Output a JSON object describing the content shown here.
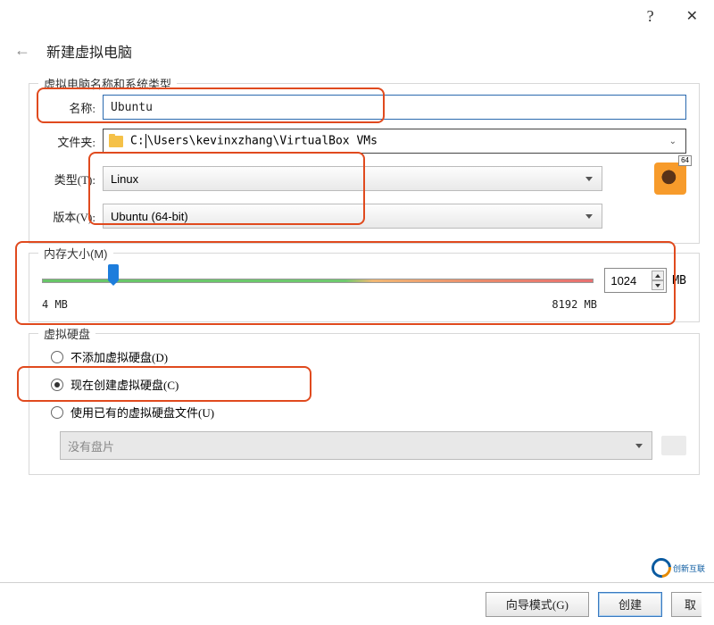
{
  "titlebar": {
    "help": "?",
    "close": "✕"
  },
  "header": {
    "back": "←",
    "title": "新建虚拟电脑"
  },
  "group_name": {
    "legend": "虚拟电脑名称和系统类型",
    "name_label": "名称:",
    "name_value": "Ubuntu",
    "folder_label": "文件夹:",
    "folder_value": "C:\\Users\\kevinxzhang\\VirtualBox VMs",
    "type_label": "类型(T):",
    "type_value": "Linux",
    "version_label": "版本(V):",
    "version_value": "Ubuntu (64-bit)",
    "os_badge": "64"
  },
  "memory": {
    "legend": "内存大小(M)",
    "min": "4 MB",
    "max": "8192 MB",
    "value": "1024",
    "unit": "MB"
  },
  "disk": {
    "legend": "虚拟硬盘",
    "opt_none": "不添加虚拟硬盘(D)",
    "opt_create": "现在创建虚拟硬盘(C)",
    "opt_existing": "使用已有的虚拟硬盘文件(U)",
    "path_placeholder": "没有盘片"
  },
  "buttons": {
    "guided": "向导模式(G)",
    "create": "创建",
    "cancel": "取"
  },
  "watermark": "创新互联"
}
